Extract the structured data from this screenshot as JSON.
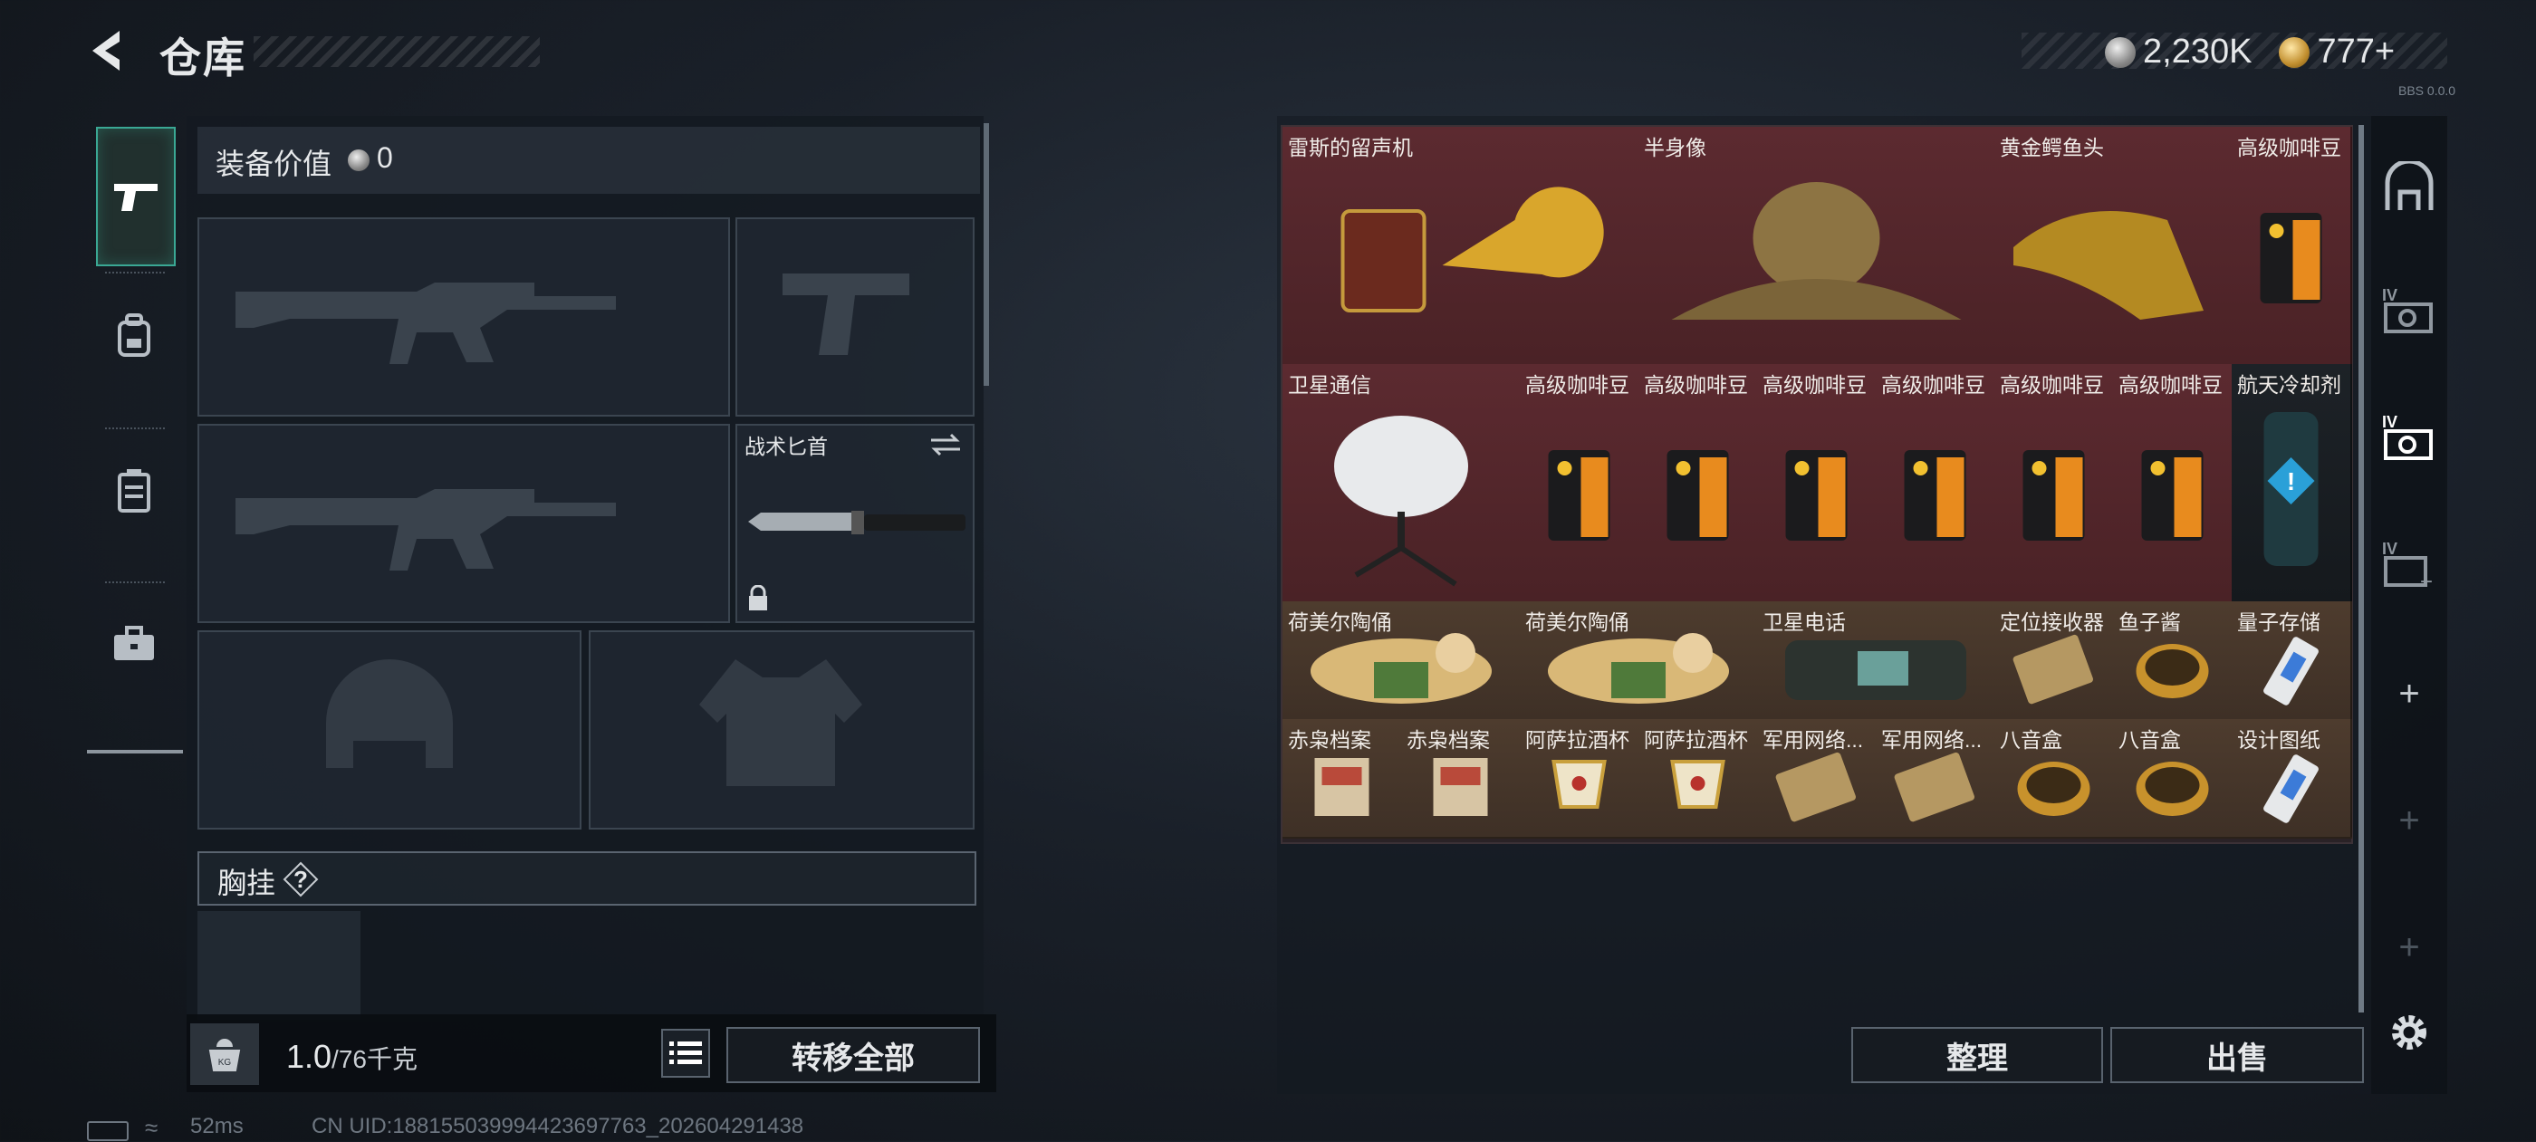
{
  "header": {
    "title": "仓库",
    "currency_silver": "2,230K",
    "currency_gold": "777",
    "currency_gold_plus": "+",
    "version": "BBS 0.0.0"
  },
  "equipment": {
    "value_label": "装备价值",
    "value": "0",
    "slots": [
      {
        "kind": "primary-weapon"
      },
      {
        "kind": "pistol"
      },
      {
        "kind": "secondary-weapon"
      },
      {
        "kind": "melee",
        "label": "战术匕首",
        "locked": true
      },
      {
        "kind": "helmet"
      },
      {
        "kind": "armor"
      }
    ],
    "chest_label": "胸挂",
    "chest_help": "?"
  },
  "footer_left": {
    "weight_current": "1.0",
    "weight_max": "/76千克",
    "transfer_all": "转移全部"
  },
  "status_bar": {
    "ping": "52ms",
    "uid": "CN UID:188155039994423697763_202604291438"
  },
  "inventory": [
    {
      "name": "雷斯的留声机",
      "color": "red"
    },
    {
      "name": "半身像",
      "color": "red"
    },
    {
      "name": "黄金鳄鱼头",
      "color": "red"
    },
    {
      "name": "高级咖啡豆",
      "color": "red"
    },
    {
      "name": "卫星通信",
      "color": "red"
    },
    {
      "name": "高级咖啡豆",
      "color": "red"
    },
    {
      "name": "高级咖啡豆",
      "color": "red"
    },
    {
      "name": "高级咖啡豆",
      "color": "red"
    },
    {
      "name": "高级咖啡豆",
      "color": "red"
    },
    {
      "name": "高级咖啡豆",
      "color": "red"
    },
    {
      "name": "高级咖啡豆",
      "color": "red"
    },
    {
      "name": "航天冷却剂",
      "color": "dark"
    },
    {
      "name": "荷美尔陶俑",
      "color": "brown"
    },
    {
      "name": "荷美尔陶俑",
      "color": "brown"
    },
    {
      "name": "卫星电话",
      "color": "brown"
    },
    {
      "name": "定位接收器",
      "color": "brown"
    },
    {
      "name": "鱼子酱",
      "color": "brown"
    },
    {
      "name": "量子存储",
      "color": "brown"
    },
    {
      "name": "赤枭档案",
      "color": "brown"
    },
    {
      "name": "赤枭档案",
      "color": "brown"
    },
    {
      "name": "阿萨拉酒杯",
      "color": "brown"
    },
    {
      "name": "阿萨拉酒杯",
      "color": "brown"
    },
    {
      "name": "军用网络...",
      "color": "brown"
    },
    {
      "name": "军用网络...",
      "color": "brown"
    },
    {
      "name": "八音盒",
      "color": "brown"
    },
    {
      "name": "八音盒",
      "color": "brown"
    },
    {
      "name": "设计图纸",
      "color": "brown"
    }
  ],
  "actions": {
    "sort": "整理",
    "sell": "出售"
  },
  "side_tabs": [
    "safe-box-icon",
    "container-iv-1-icon",
    "container-iv-2-icon",
    "container-iv-3-icon",
    "add-icon",
    "add-icon",
    "add-icon",
    "settings-icon"
  ]
}
